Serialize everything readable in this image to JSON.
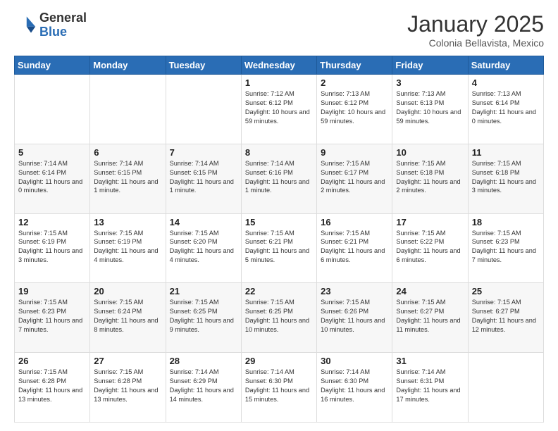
{
  "header": {
    "logo_general": "General",
    "logo_blue": "Blue",
    "month_title": "January 2025",
    "location": "Colonia Bellavista, Mexico"
  },
  "days_of_week": [
    "Sunday",
    "Monday",
    "Tuesday",
    "Wednesday",
    "Thursday",
    "Friday",
    "Saturday"
  ],
  "weeks": [
    [
      {
        "day": "",
        "info": ""
      },
      {
        "day": "",
        "info": ""
      },
      {
        "day": "",
        "info": ""
      },
      {
        "day": "1",
        "info": "Sunrise: 7:12 AM\nSunset: 6:12 PM\nDaylight: 10 hours and 59 minutes."
      },
      {
        "day": "2",
        "info": "Sunrise: 7:13 AM\nSunset: 6:12 PM\nDaylight: 10 hours and 59 minutes."
      },
      {
        "day": "3",
        "info": "Sunrise: 7:13 AM\nSunset: 6:13 PM\nDaylight: 10 hours and 59 minutes."
      },
      {
        "day": "4",
        "info": "Sunrise: 7:13 AM\nSunset: 6:14 PM\nDaylight: 11 hours and 0 minutes."
      }
    ],
    [
      {
        "day": "5",
        "info": "Sunrise: 7:14 AM\nSunset: 6:14 PM\nDaylight: 11 hours and 0 minutes."
      },
      {
        "day": "6",
        "info": "Sunrise: 7:14 AM\nSunset: 6:15 PM\nDaylight: 11 hours and 1 minute."
      },
      {
        "day": "7",
        "info": "Sunrise: 7:14 AM\nSunset: 6:15 PM\nDaylight: 11 hours and 1 minute."
      },
      {
        "day": "8",
        "info": "Sunrise: 7:14 AM\nSunset: 6:16 PM\nDaylight: 11 hours and 1 minute."
      },
      {
        "day": "9",
        "info": "Sunrise: 7:15 AM\nSunset: 6:17 PM\nDaylight: 11 hours and 2 minutes."
      },
      {
        "day": "10",
        "info": "Sunrise: 7:15 AM\nSunset: 6:18 PM\nDaylight: 11 hours and 2 minutes."
      },
      {
        "day": "11",
        "info": "Sunrise: 7:15 AM\nSunset: 6:18 PM\nDaylight: 11 hours and 3 minutes."
      }
    ],
    [
      {
        "day": "12",
        "info": "Sunrise: 7:15 AM\nSunset: 6:19 PM\nDaylight: 11 hours and 3 minutes."
      },
      {
        "day": "13",
        "info": "Sunrise: 7:15 AM\nSunset: 6:19 PM\nDaylight: 11 hours and 4 minutes."
      },
      {
        "day": "14",
        "info": "Sunrise: 7:15 AM\nSunset: 6:20 PM\nDaylight: 11 hours and 4 minutes."
      },
      {
        "day": "15",
        "info": "Sunrise: 7:15 AM\nSunset: 6:21 PM\nDaylight: 11 hours and 5 minutes."
      },
      {
        "day": "16",
        "info": "Sunrise: 7:15 AM\nSunset: 6:21 PM\nDaylight: 11 hours and 6 minutes."
      },
      {
        "day": "17",
        "info": "Sunrise: 7:15 AM\nSunset: 6:22 PM\nDaylight: 11 hours and 6 minutes."
      },
      {
        "day": "18",
        "info": "Sunrise: 7:15 AM\nSunset: 6:23 PM\nDaylight: 11 hours and 7 minutes."
      }
    ],
    [
      {
        "day": "19",
        "info": "Sunrise: 7:15 AM\nSunset: 6:23 PM\nDaylight: 11 hours and 7 minutes."
      },
      {
        "day": "20",
        "info": "Sunrise: 7:15 AM\nSunset: 6:24 PM\nDaylight: 11 hours and 8 minutes."
      },
      {
        "day": "21",
        "info": "Sunrise: 7:15 AM\nSunset: 6:25 PM\nDaylight: 11 hours and 9 minutes."
      },
      {
        "day": "22",
        "info": "Sunrise: 7:15 AM\nSunset: 6:25 PM\nDaylight: 11 hours and 10 minutes."
      },
      {
        "day": "23",
        "info": "Sunrise: 7:15 AM\nSunset: 6:26 PM\nDaylight: 11 hours and 10 minutes."
      },
      {
        "day": "24",
        "info": "Sunrise: 7:15 AM\nSunset: 6:27 PM\nDaylight: 11 hours and 11 minutes."
      },
      {
        "day": "25",
        "info": "Sunrise: 7:15 AM\nSunset: 6:27 PM\nDaylight: 11 hours and 12 minutes."
      }
    ],
    [
      {
        "day": "26",
        "info": "Sunrise: 7:15 AM\nSunset: 6:28 PM\nDaylight: 11 hours and 13 minutes."
      },
      {
        "day": "27",
        "info": "Sunrise: 7:15 AM\nSunset: 6:28 PM\nDaylight: 11 hours and 13 minutes."
      },
      {
        "day": "28",
        "info": "Sunrise: 7:14 AM\nSunset: 6:29 PM\nDaylight: 11 hours and 14 minutes."
      },
      {
        "day": "29",
        "info": "Sunrise: 7:14 AM\nSunset: 6:30 PM\nDaylight: 11 hours and 15 minutes."
      },
      {
        "day": "30",
        "info": "Sunrise: 7:14 AM\nSunset: 6:30 PM\nDaylight: 11 hours and 16 minutes."
      },
      {
        "day": "31",
        "info": "Sunrise: 7:14 AM\nSunset: 6:31 PM\nDaylight: 11 hours and 17 minutes."
      },
      {
        "day": "",
        "info": ""
      }
    ]
  ]
}
